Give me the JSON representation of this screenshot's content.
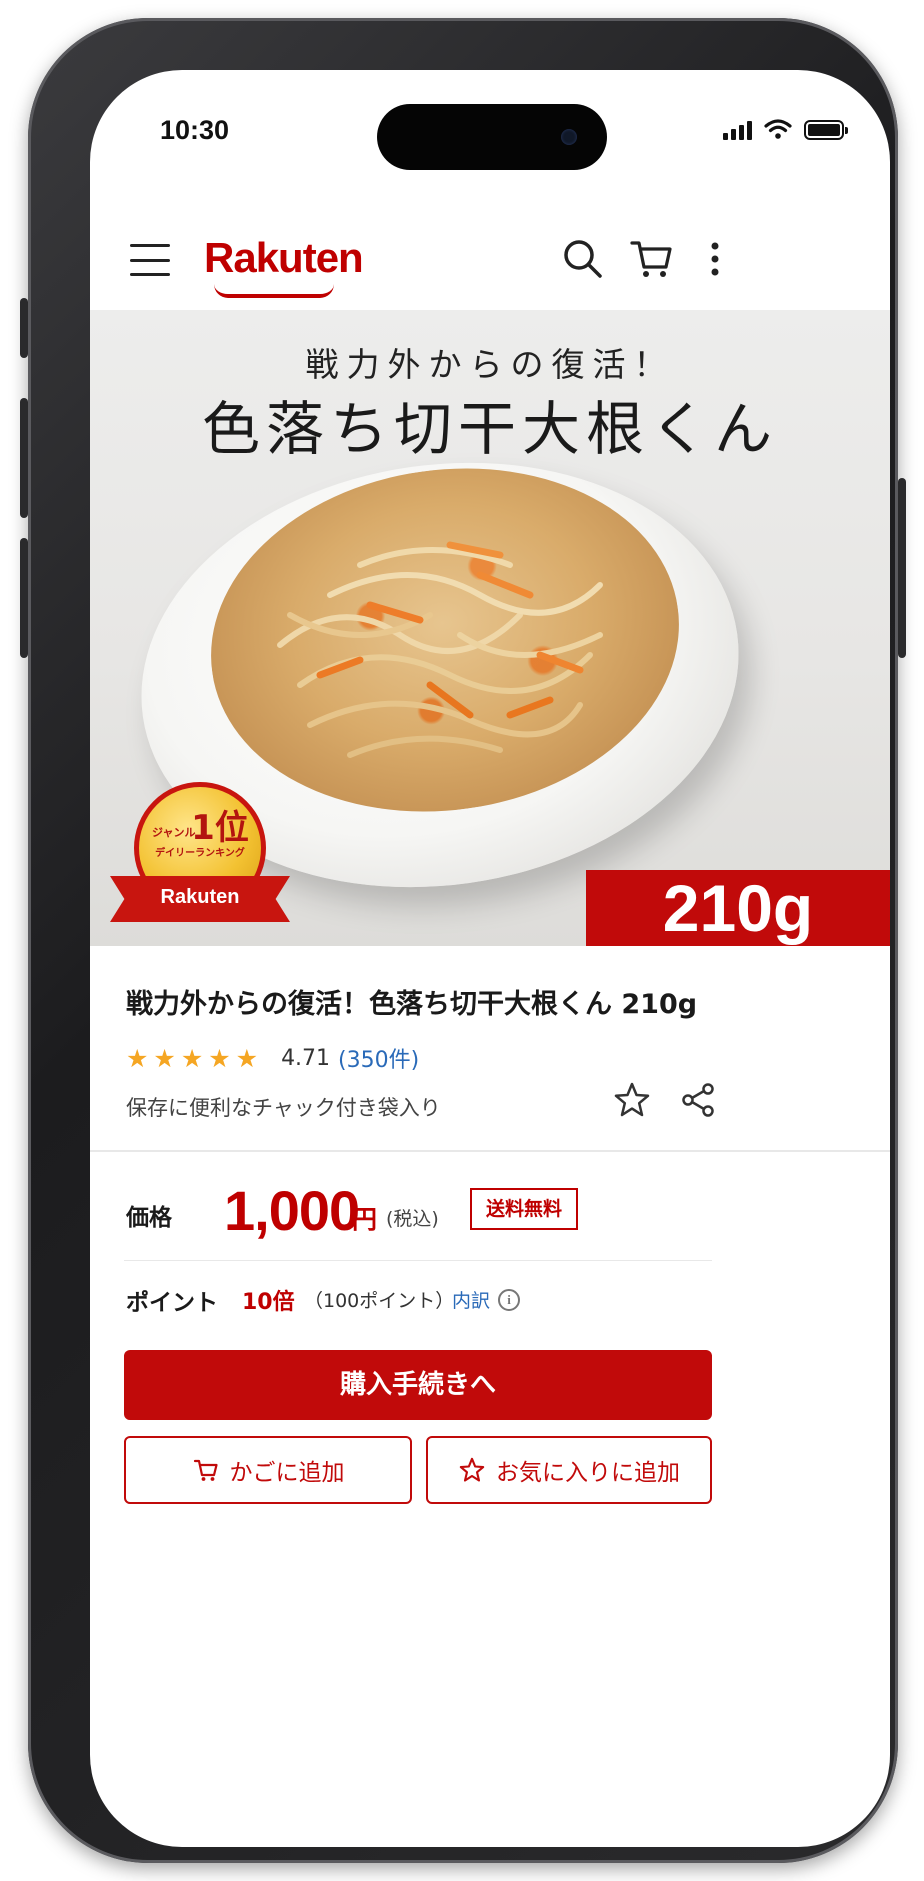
{
  "status_bar": {
    "time": "10:30"
  },
  "header": {
    "logo_text": "Rakuten",
    "menu_icon": "hamburger-icon",
    "search_icon": "search-icon",
    "cart_icon": "cart-icon",
    "more_icon": "more-vertical-icon"
  },
  "hero": {
    "subtitle": "戦力外からの復活！",
    "title": "色落ち切干大根くん",
    "weight_tag": "210g",
    "badge": {
      "genre": "ジャンル",
      "rank": "1位",
      "ranking": "デイリーランキング",
      "logo": "Rakuten"
    }
  },
  "product": {
    "title": "戦力外からの復活！色落ち切干大根くん 210g",
    "stars": "★★★★★",
    "rating": "4.71",
    "reviews": "(350件)",
    "subtitle": "保存に便利なチャック付き袋入り"
  },
  "price": {
    "label": "価格",
    "amount": "1,000",
    "currency": "円",
    "tax_note": "(税込)",
    "shipping": "送料無料"
  },
  "points": {
    "label": "ポイント",
    "multiplier": "10倍",
    "detail": "（100ポイント）",
    "breakdown_link": "内訳"
  },
  "buttons": {
    "buy": "購入手続きへ",
    "add_to_cart": "かごに追加",
    "add_to_favorites": "お気に入りに追加"
  },
  "colors": {
    "brand_red": "#bf0000",
    "star_orange": "#f5a623",
    "link_blue": "#2a6ab8"
  }
}
